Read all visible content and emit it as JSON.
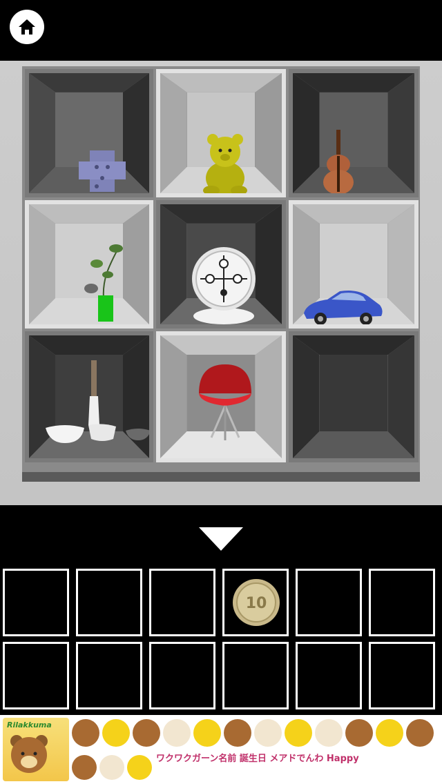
{
  "header": {
    "home_icon": "home-icon"
  },
  "scene": {
    "shelf_items": [
      {
        "name": "blue-block-puzzle",
        "cell": "top-left"
      },
      {
        "name": "yellow-teddy-bear",
        "cell": "top-center"
      },
      {
        "name": "violin",
        "cell": "top-right"
      },
      {
        "name": "plant-in-green-vase",
        "cell": "middle-left"
      },
      {
        "name": "clock-dial-puzzle",
        "cell": "middle-center"
      },
      {
        "name": "blue-toy-car",
        "cell": "middle-right"
      },
      {
        "name": "mortar-and-pestle-bowls",
        "cell": "bottom-left"
      },
      {
        "name": "red-egg-chair",
        "cell": "bottom-center"
      },
      {
        "name": "empty-dark-cubby",
        "cell": "bottom-right"
      }
    ]
  },
  "navigation": {
    "down_arrow_icon": "down-arrow-icon"
  },
  "inventory": {
    "slots": 12,
    "items": [
      {
        "slot": 4,
        "name": "10-yen-coin",
        "label": "10"
      }
    ]
  },
  "ad": {
    "brand": "Rilakkuma",
    "tagline": "ワクワクガーン名前 誕生日 メアドでんわ Happy"
  },
  "colors": {
    "background": "#000000",
    "scene_wall": "#c8c8c8",
    "shelf_light": "#e2e2e2",
    "shelf_dark": "#7a7a7a",
    "slot_border": "#ffffff"
  }
}
